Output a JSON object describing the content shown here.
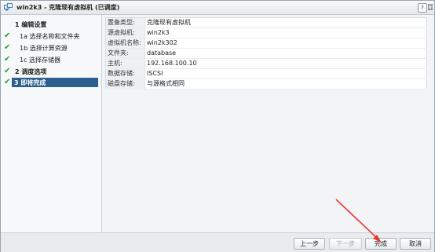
{
  "window": {
    "title": "win2k3 - 克隆现有虚拟机 (已调度)",
    "help_label": "?",
    "title_icon": "vm-clone-icon"
  },
  "steps": [
    {
      "num": "1",
      "label": "编辑设置",
      "done": true,
      "bold": true
    },
    {
      "num": "1a",
      "label": "选择名称和文件夹",
      "done": true,
      "bold": false
    },
    {
      "num": "1b",
      "label": "选择计算资源",
      "done": true,
      "bold": false
    },
    {
      "num": "1c",
      "label": "选择存储器",
      "done": true,
      "bold": false
    },
    {
      "num": "2",
      "label": "调度选项",
      "done": true,
      "bold": true
    },
    {
      "num": "3",
      "label": "即将完成",
      "done": true,
      "bold": true,
      "active": true
    }
  ],
  "properties": [
    {
      "key": "置备类型:",
      "value": "克隆现有虚拟机"
    },
    {
      "key": "源虚拟机:",
      "value": "win2k3"
    },
    {
      "key": "虚拟机名称:",
      "value": "win2k302"
    },
    {
      "key": "文件夹:",
      "value": "database"
    },
    {
      "key": "主机:",
      "value": "192.168.100.10"
    },
    {
      "key": "数据存储:",
      "value": "ISCSI"
    },
    {
      "key": "磁盘存储:",
      "value": "与源格式相同"
    }
  ],
  "footer": {
    "back_label": "上一步",
    "next_label": "下一步",
    "finish_label": "完成",
    "cancel_label": "取消"
  },
  "colors": {
    "active_step": "#2c5f8f",
    "check": "#2e9a3e",
    "annotation_arrow": "#e53935"
  }
}
